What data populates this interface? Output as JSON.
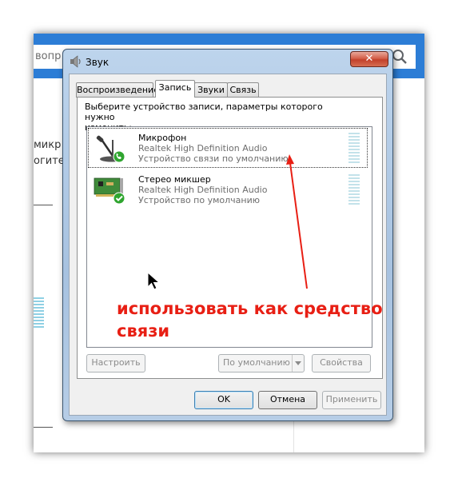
{
  "background_window": {
    "search_text": "вопр",
    "text_line_1": "микр",
    "text_line_2": "огите"
  },
  "dialog": {
    "title": "Звук",
    "tabs": [
      {
        "label": "Воспроизведение",
        "active": false
      },
      {
        "label": "Запись",
        "active": true
      },
      {
        "label": "Звуки",
        "active": false
      },
      {
        "label": "Связь",
        "active": false
      }
    ],
    "prompt": "Выберите устройство записи, параметры которого нужно\nизменить:",
    "devices": [
      {
        "name": "Микрофон",
        "driver": "Realtek High Definition Audio",
        "status": "Устройство связи по умолчанию",
        "icon": "microphone-icon",
        "badge": "phone-check-badge",
        "selected": true
      },
      {
        "name": "Стерео микшер",
        "driver": "Realtek High Definition Audio",
        "status": "Устройство по умолчанию",
        "icon": "sound-card-icon",
        "badge": "green-check-badge",
        "selected": false
      }
    ],
    "buttons": {
      "configure": "Настроить",
      "set_default": "По умолчанию",
      "properties": "Свойства",
      "ok": "OK",
      "cancel": "Отмена",
      "apply": "Применить"
    }
  },
  "annotation": {
    "text": "использовать как средство связи",
    "color": "#e81f14"
  },
  "colors": {
    "accent_blue": "#2c7dd6",
    "level_meter": "#c3e2ea",
    "badge_green": "#2fa52f"
  }
}
